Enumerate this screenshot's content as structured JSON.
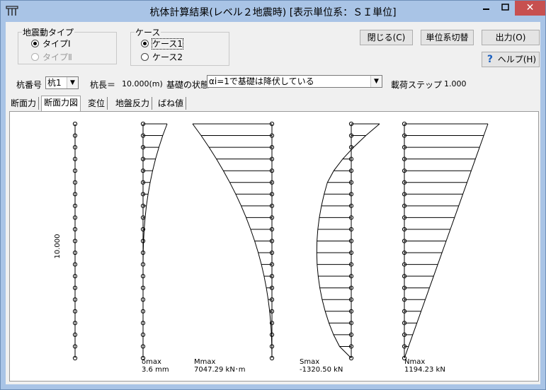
{
  "window": {
    "title": "杭体計算結果(レベル２地震時) [表示単位系：ＳＩ単位]",
    "close_glyph": "✕"
  },
  "quake_type": {
    "legend": "地震動タイプ",
    "options": [
      "タイプⅠ",
      "タイプⅡ"
    ],
    "selected": 0
  },
  "case": {
    "legend": "ケース",
    "options": [
      "ケース1",
      "ケース2"
    ],
    "selected": 0
  },
  "buttons": {
    "close": "閉じる(C)",
    "unit_switch": "単位系切替",
    "output": "出力(O)",
    "help": "ヘルプ(H)",
    "help_icon": "question-mark-icon"
  },
  "pile": {
    "number_label": "杭番号",
    "number_value": "杭1",
    "length_label": "杭長＝",
    "length_value": "10.000(m)",
    "state_label": "基礎の状態",
    "state_value": "αi=1で基礎は降伏している",
    "step_label": "載荷ステップ",
    "step_value": "1.000"
  },
  "tabs": [
    "断面力",
    "断面力図",
    "変位",
    "地盤反力",
    "ばね値"
  ],
  "active_tab": 1,
  "diagram": {
    "length_label": "10.000",
    "disp": {
      "label": "δmax",
      "value": "3.6 mm"
    },
    "moment": {
      "label": "Mmax",
      "value": "7047.29 kN･m"
    },
    "shear": {
      "label": "Smax",
      "value": "-1320.50 kN"
    },
    "axial": {
      "label": "Nmax",
      "value": "1194.23 kN"
    }
  },
  "colors": {
    "titlebar": "#a9c4e6",
    "close": "#c75050",
    "canvas": "#ffffff"
  }
}
